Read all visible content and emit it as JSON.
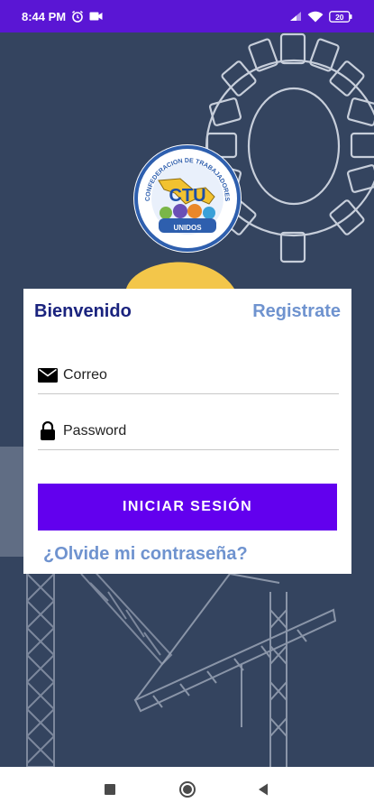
{
  "status_bar": {
    "time": "8:44 PM",
    "battery_level": "20",
    "icons": [
      "alarm-icon",
      "video-record-icon",
      "signal-icon",
      "wifi-icon",
      "battery-icon"
    ]
  },
  "logo": {
    "text_arc_top": "CONFEDERACION DE TRABAJADORES",
    "text_center": "CTU",
    "text_bottom": "UNIDOS"
  },
  "login_card": {
    "title": "Bienvenido",
    "register_link": "Registrate",
    "email_placeholder": "Correo",
    "password_placeholder": "Password",
    "submit_label": "INICIAR SESIÓN",
    "forgot_password": "¿Olvide mi contraseña?"
  },
  "colors": {
    "status_bar": "#5a16d4",
    "background": "#34445f",
    "title": "#1a237e",
    "link": "#6f93cf",
    "button": "#6200ee"
  },
  "nav_bar": {
    "buttons": [
      "recents-icon",
      "home-icon",
      "back-icon"
    ]
  }
}
